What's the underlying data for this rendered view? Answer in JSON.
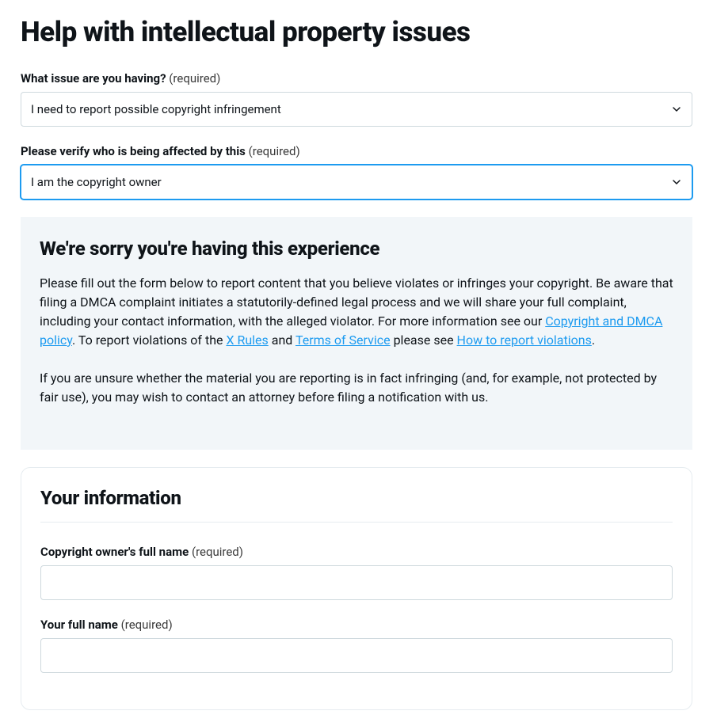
{
  "page": {
    "title": "Help with intellectual property issues"
  },
  "required_suffix": "(required)",
  "issue": {
    "label": "What issue are you having?",
    "selected": "I need to report possible copyright infringement"
  },
  "affected": {
    "label": "Please verify who is being affected by this",
    "selected": "I am the copyright owner"
  },
  "notice": {
    "title": "We're sorry you're having this experience",
    "p1_a": "Please fill out the form below to report content that you believe violates or infringes your copyright. Be aware that filing a DMCA complaint initiates a statutorily-defined legal process and we will share your full complaint, including your contact information, with the alleged violator. For more information see our ",
    "link1": "Copyright and DMCA policy",
    "p1_b": ". To report violations of the ",
    "link2": "X Rules",
    "p1_c": " and ",
    "link3": "Terms of Service",
    "p1_d": " please see ",
    "link4": "How to report violations",
    "p1_e": ".",
    "p2": "If you are unsure whether the material you are reporting is in fact infringing (and, for example, not protected by fair use), you may wish to contact an attorney before filing a notification with us."
  },
  "your_info": {
    "title": "Your information",
    "owner_name_label": "Copyright owner's full name",
    "your_name_label": "Your full name"
  }
}
